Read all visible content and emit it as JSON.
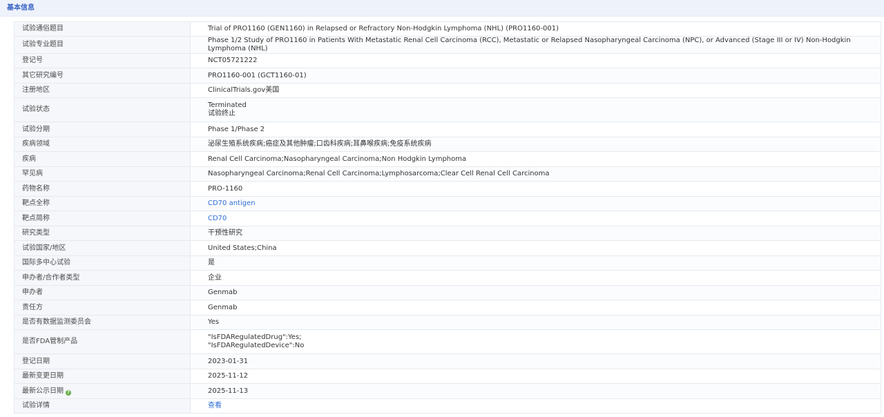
{
  "section": {
    "title": "基本信息"
  },
  "rows": [
    {
      "label": "试验通俗题目",
      "value": "Trial of PRO1160 (GEN1160) in Relapsed or Refractory Non-Hodgkin Lymphoma (NHL) (PRO1160-001)"
    },
    {
      "label": "试验专业题目",
      "value": "Phase 1/2 Study of PRO1160 in Patients With Metastatic Renal Cell Carcinoma (RCC), Metastatic or Relapsed Nasopharyngeal Carcinoma (NPC), or Advanced (Stage III or IV) Non-Hodgkin Lymphoma (NHL)"
    },
    {
      "label": "登记号",
      "value": "NCT05721222"
    },
    {
      "label": "其它研究编号",
      "value": "PRO1160-001 (GCT1160-01)"
    },
    {
      "label": "注册地区",
      "value": "ClinicalTrials.gov美国"
    },
    {
      "label": "试验状态",
      "value_line1": "Terminated",
      "value_line2": "试验终止"
    },
    {
      "label": "试验分期",
      "value": "Phase 1/Phase 2"
    },
    {
      "label": "疾病领域",
      "value": "泌尿生殖系统疾病;癌症及其他肿瘤;口齿科疾病;耳鼻喉疾病;免疫系统疾病"
    },
    {
      "label": "疾病",
      "value": "Renal Cell Carcinoma;Nasopharyngeal Carcinoma;Non Hodgkin Lymphoma"
    },
    {
      "label": "罕见病",
      "value": "Nasopharyngeal Carcinoma;Renal Cell Carcinoma;Lymphosarcoma;Clear Cell Renal Cell Carcinoma"
    },
    {
      "label": "药物名称",
      "value": "PRO-1160"
    },
    {
      "label": "靶点全称",
      "value": "CD70 antigen"
    },
    {
      "label": "靶点简称",
      "value": "CD70"
    },
    {
      "label": "研究类型",
      "value": "干预性研究"
    },
    {
      "label": "试验国家/地区",
      "value": "United States;China"
    },
    {
      "label": "国际多中心试验",
      "value": "是"
    },
    {
      "label": "申办者/合作者类型",
      "value": "企业"
    },
    {
      "label": "申办者",
      "value": "Genmab"
    },
    {
      "label": "责任方",
      "value": "Genmab"
    },
    {
      "label": "是否有数据监测委员会",
      "value": "Yes"
    },
    {
      "label": "是否FDA管制产品",
      "value_line1": "\"IsFDARegulatedDrug\":Yes;",
      "value_line2": "\"IsFDARegulatedDevice\":No"
    },
    {
      "label": "登记日期",
      "value": "2023-01-31"
    },
    {
      "label": "最新变更日期",
      "value": "2025-11-12"
    },
    {
      "label": "最新公示日期",
      "value": "2025-11-13",
      "info_icon": "info-icon"
    },
    {
      "label": "试验详情",
      "value": "查看"
    }
  ],
  "colors": {
    "accent": "#3b67c5",
    "link": "#2f6fd6",
    "info_icon": "#6ab04c"
  }
}
